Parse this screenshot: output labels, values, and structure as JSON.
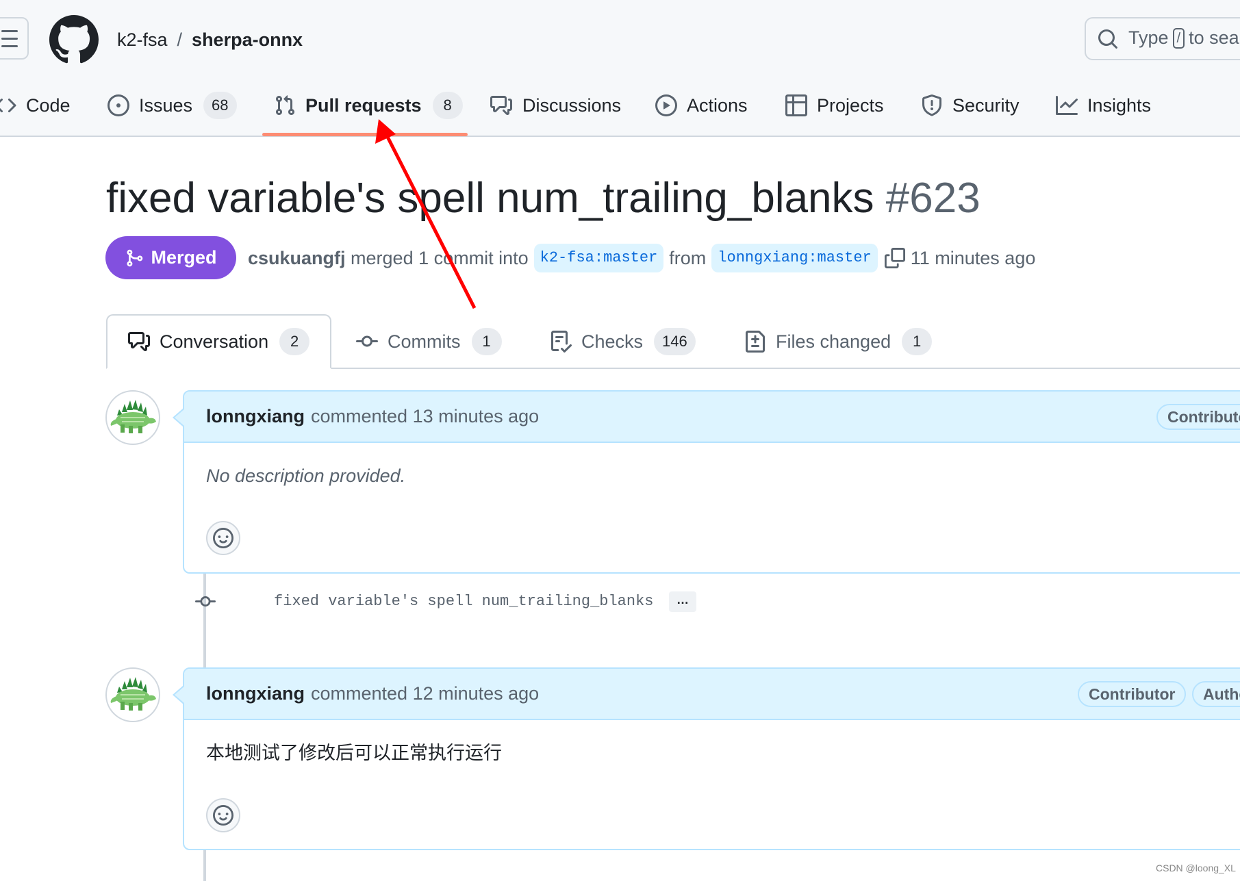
{
  "header": {
    "owner": "k2-fsa",
    "separator": "/",
    "repo": "sherpa-onnx",
    "search_before": "Type",
    "search_key": "/",
    "search_after": "to search"
  },
  "nav": {
    "items": [
      {
        "label": "Code",
        "icon": "code-icon"
      },
      {
        "label": "Issues",
        "icon": "issue-opened-icon",
        "count": "68"
      },
      {
        "label": "Pull requests",
        "icon": "git-pull-request-icon",
        "count": "8",
        "active": true
      },
      {
        "label": "Discussions",
        "icon": "comment-discussion-icon"
      },
      {
        "label": "Actions",
        "icon": "play-icon"
      },
      {
        "label": "Projects",
        "icon": "table-icon"
      },
      {
        "label": "Security",
        "icon": "shield-icon"
      },
      {
        "label": "Insights",
        "icon": "graph-icon"
      }
    ],
    "accent": "#fd8c73"
  },
  "pr": {
    "title": "fixed variable's spell num_trailing_blanks",
    "number": "#623",
    "state": "Merged",
    "state_color": "#8250df",
    "merged_by": "csukuangfj",
    "merge_text": "merged 1 commit into",
    "base_branch": "k2-fsa:master",
    "from_text": "from",
    "head_branch": "lonngxiang:master",
    "time": "11 minutes ago"
  },
  "tabs": [
    {
      "label": "Conversation",
      "count": "2",
      "active": true
    },
    {
      "label": "Commits",
      "count": "1"
    },
    {
      "label": "Checks",
      "count": "146"
    },
    {
      "label": "Files changed",
      "count": "1"
    }
  ],
  "comments": [
    {
      "author": "lonngxiang",
      "action": "commented 13 minutes ago",
      "labels": [
        "Contributor"
      ],
      "body": "No description provided.",
      "body_italic": true
    },
    {
      "author": "lonngxiang",
      "action": "commented 12 minutes ago",
      "labels": [
        "Contributor",
        "Author"
      ],
      "body": "本地测试了修改后可以正常执行运行",
      "body_italic": false
    }
  ],
  "commit": {
    "message": "fixed variable's spell num_trailing_blanks",
    "more": "…"
  },
  "watermark": "CSDN @loong_XL",
  "annotation": {
    "color": "#ff0000",
    "target": "Pull requests tab"
  }
}
